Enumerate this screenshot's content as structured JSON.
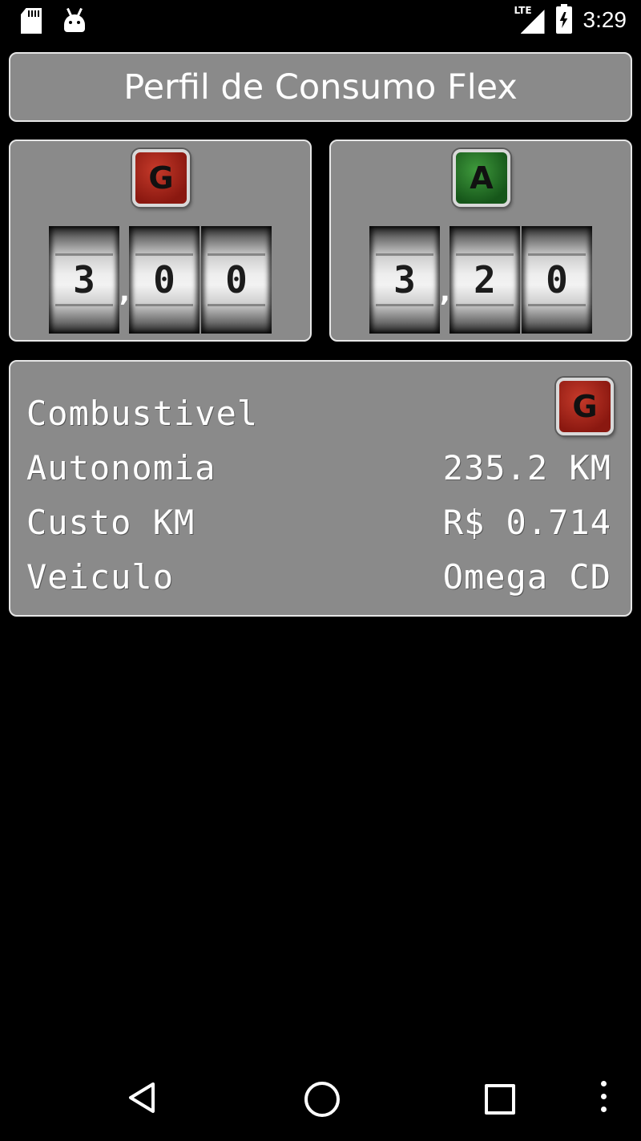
{
  "status_bar": {
    "network": "LTE",
    "time": "3:29",
    "icons": [
      "sd-card-icon",
      "android-debug-icon",
      "signal-icon",
      "battery-charging-icon"
    ]
  },
  "title": "Perfil de Consumo Flex",
  "fuel_gasolina": {
    "badge": "G",
    "badge_color": "#a8281c",
    "digits": [
      "3",
      "0",
      "0"
    ],
    "separator": ","
  },
  "fuel_alcool": {
    "badge": "A",
    "badge_color": "#2a7a2a",
    "digits": [
      "3",
      "2",
      "0"
    ],
    "separator": ","
  },
  "info": {
    "combustivel_label": "Combustivel",
    "combustivel_badge": "G",
    "autonomia_label": "Autonomia",
    "autonomia_value": "235.2 KM",
    "custo_label": "Custo KM",
    "custo_value": "R$ 0.714",
    "veiculo_label": "Veiculo",
    "veiculo_value": "Omega CD"
  },
  "colors": {
    "panel": "#8a8a8a",
    "panel_border": "#e6e6e6",
    "background": "#000000"
  },
  "nav_bar": {
    "icons": [
      "back-icon",
      "home-icon",
      "recent-apps-icon",
      "overflow-menu-icon"
    ]
  }
}
